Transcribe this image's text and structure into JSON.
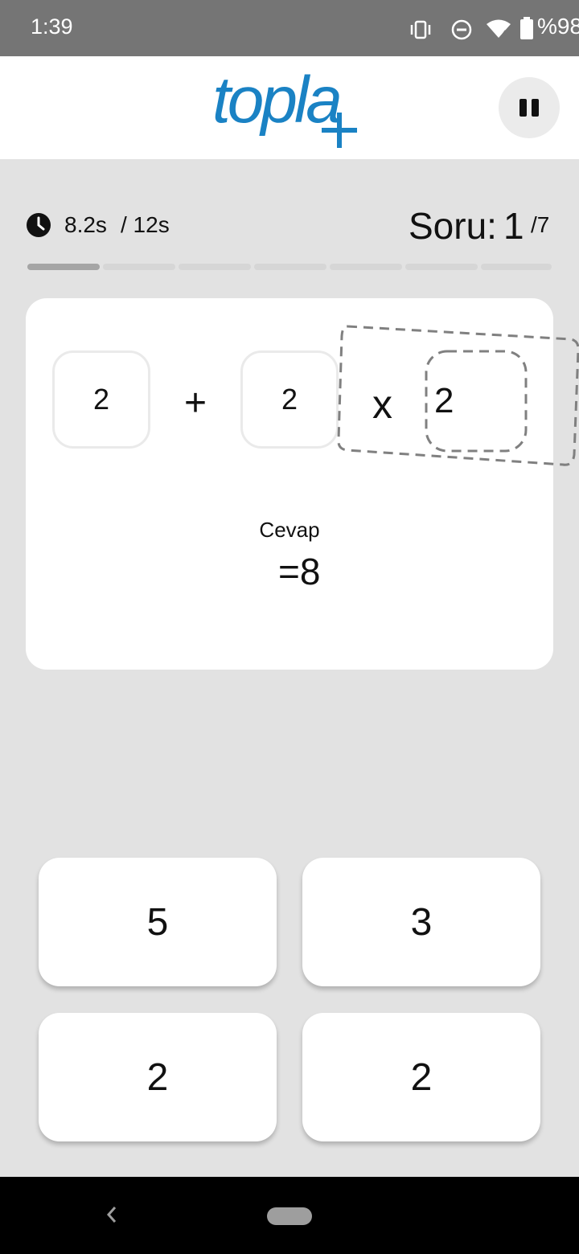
{
  "status": {
    "time": "1:39",
    "battery": "%98",
    "icons": [
      "vibrate-icon",
      "do-not-disturb-icon",
      "wifi-icon",
      "battery-icon"
    ]
  },
  "header": {
    "logo_text": "topla",
    "pause_icon": "pause-icon"
  },
  "timer": {
    "elapsed": "8.2s",
    "total": "/ 12s"
  },
  "question": {
    "label": "Soru:",
    "current": "1",
    "total": "/7",
    "progress_fraction": 0.142857
  },
  "equation": {
    "a": "2",
    "op1": "+",
    "b": "2",
    "op2": "x",
    "c": "2"
  },
  "answer": {
    "label": "Cevap",
    "value": "=8"
  },
  "choices": [
    "5",
    "3",
    "2",
    "2"
  ],
  "colors": {
    "logo": "#1a82c4",
    "status_bar": "#757575",
    "background": "#e2e2e2"
  }
}
